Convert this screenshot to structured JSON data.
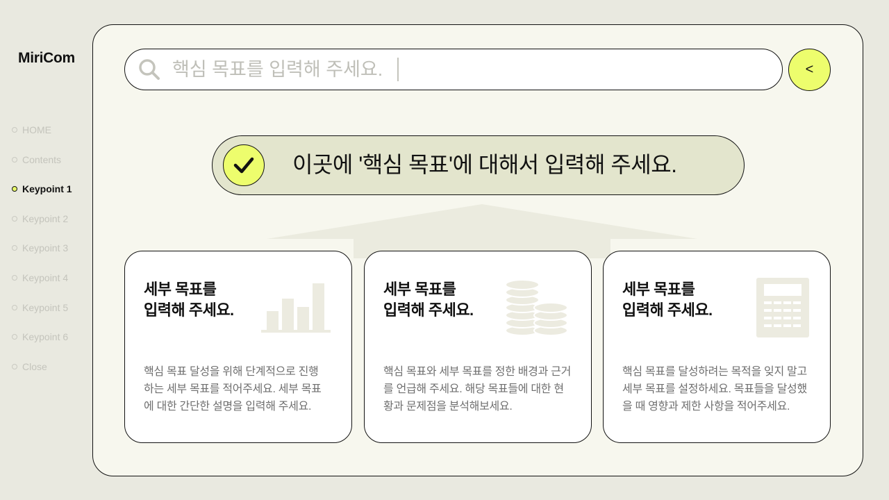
{
  "brand": {
    "logo": "MiriCom"
  },
  "nav": {
    "items": [
      {
        "label": "HOME",
        "active": false
      },
      {
        "label": "Contents",
        "active": false
      },
      {
        "label": "Keypoint 1",
        "active": true
      },
      {
        "label": "Keypoint 2",
        "active": false
      },
      {
        "label": "Keypoint 3",
        "active": false
      },
      {
        "label": "Keypoint 4",
        "active": false
      },
      {
        "label": "Keypoint 5",
        "active": false
      },
      {
        "label": "Keypoint 6",
        "active": false
      },
      {
        "label": "Close",
        "active": false
      }
    ]
  },
  "search": {
    "placeholder": "핵심 목표를 입력해 주세요.",
    "value": ""
  },
  "back_button": {
    "label": "<"
  },
  "banner": {
    "text": "이곳에 '핵심 목표'에 대해서 입력해 주세요."
  },
  "cards": [
    {
      "title_line1": "세부 목표를",
      "title_line2": "입력해 주세요.",
      "body_line1": "핵심 목표 달성을 위해 단계적으로 진행",
      "body_line2": "하는 세부 목표를 적어주세요. 세부 목표",
      "body_line3": "에 대한 간단한 설명을 입력해 주세요.",
      "icon": "bar-chart-icon"
    },
    {
      "title_line1": "세부 목표를",
      "title_line2": "입력해 주세요.",
      "body_line1": "핵심 목표와 세부 목표를 정한 배경과 근거",
      "body_line2": "를 언급해 주세요. 해당 목표들에 대한 현",
      "body_line3": "황과 문제점을 분석해보세요.",
      "icon": "coins-icon"
    },
    {
      "title_line1": "세부 목표를",
      "title_line2": "입력해 주세요.",
      "body_line1": "핵심 목표를 달성하려는 목적을 잊지 말고",
      "body_line2": "세부 목표를 설정하세요. 목표들을 달성했",
      "body_line3": "을 때 영향과 제한 사항을 적어주세요.",
      "icon": "calculator-icon"
    }
  ],
  "colors": {
    "accent": "#edfd6d",
    "panel_bg": "#f7f7ee",
    "page_bg": "#e9e9e0",
    "banner_bg": "#e3e5cd",
    "outline": "#111111",
    "muted_text": "#c4c4bc"
  }
}
